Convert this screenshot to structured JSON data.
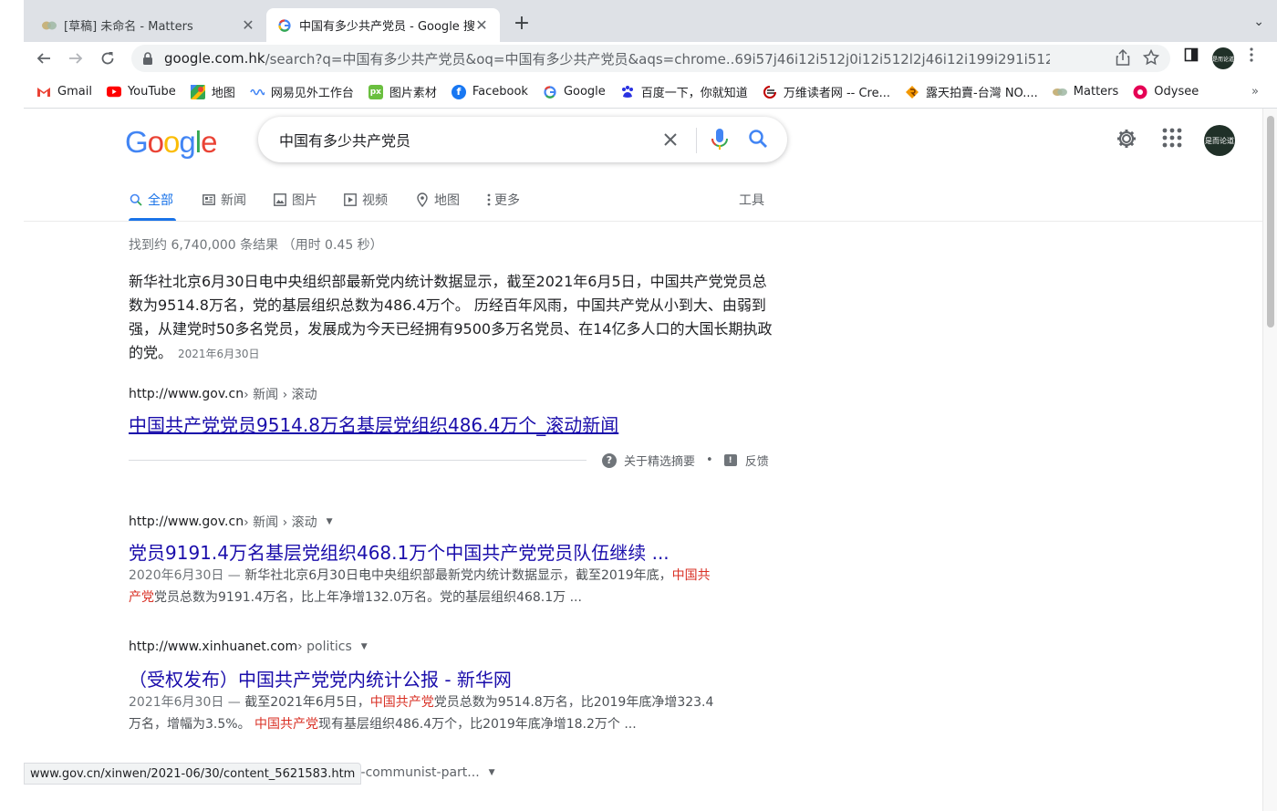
{
  "browser": {
    "tabs": [
      {
        "title": "[草稿] 未命名 - Matters",
        "active": false
      },
      {
        "title": "中国有多少共产党员 - Google 搜",
        "active": true
      }
    ],
    "new_tab": "+",
    "tab_close": "✕",
    "tab_menu": "⌄",
    "url_host": "google.com.hk",
    "url_path": "/search?q=中国有多少共产党员&oq=中国有多少共产党员&aqs=chrome..69i57j46i12i512j0i12i512l2j46i12i199i291i512j46i12i512j46i...",
    "profile_text": "是而论道",
    "bookmarks": [
      {
        "label": "Gmail",
        "icon": "gmail-icon",
        "color": "#ea4335"
      },
      {
        "label": "YouTube",
        "icon": "youtube-icon",
        "color": "#ff0000"
      },
      {
        "label": "地图",
        "icon": "maps-icon",
        "color": "#34a853"
      },
      {
        "label": "网易见外工作台",
        "icon": "wave-icon",
        "color": "#4285f4"
      },
      {
        "label": "图片素材",
        "icon": "px-icon",
        "color": "#6abf3f"
      },
      {
        "label": "Facebook",
        "icon": "facebook-icon",
        "color": "#1877f2"
      },
      {
        "label": "Google",
        "icon": "google-icon",
        "color": "#4285f4"
      },
      {
        "label": "百度一下，你就知道",
        "icon": "baidu-icon",
        "color": "#2932e1"
      },
      {
        "label": "万维读者网 -- Cre...",
        "icon": "wanwei-icon",
        "color": "#c00000"
      },
      {
        "label": "露天拍賣-台灣 NO....",
        "icon": "ruten-icon",
        "color": "#f39800"
      },
      {
        "label": "Matters",
        "icon": "matters-icon",
        "color": "#c7b37d"
      },
      {
        "label": "Odysee",
        "icon": "odysee-icon",
        "color": "#e50054"
      }
    ],
    "bookmarks_more": "»"
  },
  "search": {
    "logo": "Google",
    "query": "中国有多少共产党员",
    "avatar_text": "是而论道",
    "tabs": [
      {
        "label": "全部",
        "icon": "search-icon",
        "active": true
      },
      {
        "label": "新闻",
        "icon": "news-icon"
      },
      {
        "label": "图片",
        "icon": "image-icon"
      },
      {
        "label": "视频",
        "icon": "video-icon"
      },
      {
        "label": "地图",
        "icon": "map-pin-icon"
      },
      {
        "label": "更多",
        "icon": "more-vert-icon"
      }
    ],
    "tools": "工具",
    "stats": "找到约 6,740,000 条结果 （用时 0.45 秒）"
  },
  "featured": {
    "text": "新华社北京6月30日电中央组织部最新党内统计数据显示，截至2021年6月5日，中国共产党党员总数为9514.8万名，党的基层组织总数为486.4万个。 历经百年风雨，中国共产党从小到大、由弱到强，从建党时50多名党员，发展成为今天已经拥有9500多万名党员、在14亿多人口的大国长期执政的党。",
    "date": "2021年6月30日",
    "cite_host": "http://www.gov.cn",
    "cite_path": " › 新闻 › 滚动",
    "title": "中国共产党党员9514.8万名基层党组织486.4万个_滚动新闻",
    "about": "关于精选摘要",
    "dot": "•",
    "feedback": "反馈"
  },
  "results": [
    {
      "cite_host": "http://www.gov.cn",
      "cite_path": " › 新闻 › 滚动",
      "title": "党员9191.4万名基层党组织468.1万个中国共产党党员队伍继续 ...",
      "date": "2020年6月30日",
      "sep": " — ",
      "text1": "新华社北京6月30日电中央组织部最新党内统计数据显示，截至2019年底，",
      "em1": "中国共产党",
      "text2": "党员总数为9191.4万名，比上年净增132.0万名。党的基层组织468.1万 ..."
    },
    {
      "cite_host": "http://www.xinhuanet.com",
      "cite_path": " › politics",
      "title": "（受权发布）中国共产党党内统计公报 - 新华网",
      "date": "2021年6月30日",
      "sep": " — ",
      "text1": "截至2021年6月5日，",
      "em1": "中国共产党",
      "text2": "党员总数为9514.8万名，比2019年底净增323.4万名，增幅为3.5%。 ",
      "em2": "中国共产党",
      "text3": "现有基层组织486.4万个，比2019年底净增18.2万个 ..."
    },
    {
      "cite_path": "ese-communist-part..."
    }
  ],
  "status_url": "www.gov.cn/xinwen/2021-06/30/content_5621583.htm"
}
